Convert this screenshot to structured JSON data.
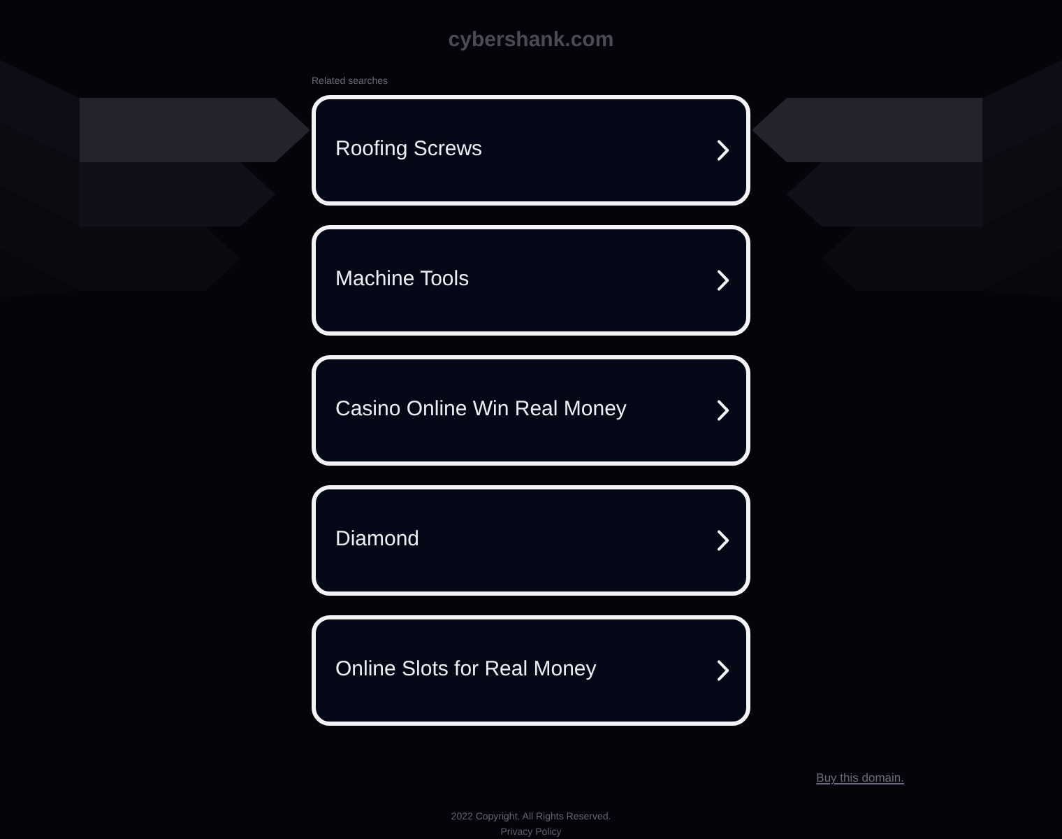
{
  "header": {
    "domain": "cybershank.com"
  },
  "related_searches": {
    "label": "Related searches",
    "items": [
      {
        "text": "Roofing Screws"
      },
      {
        "text": "Machine Tools"
      },
      {
        "text": "Casino Online Win Real Money"
      },
      {
        "text": "Diamond"
      },
      {
        "text": "Online Slots for Real Money"
      }
    ]
  },
  "buy_link": "Buy this domain.",
  "footer": {
    "copyright": "2022 Copyright. All Rights Reserved.",
    "privacy_link": "Privacy Policy"
  }
}
